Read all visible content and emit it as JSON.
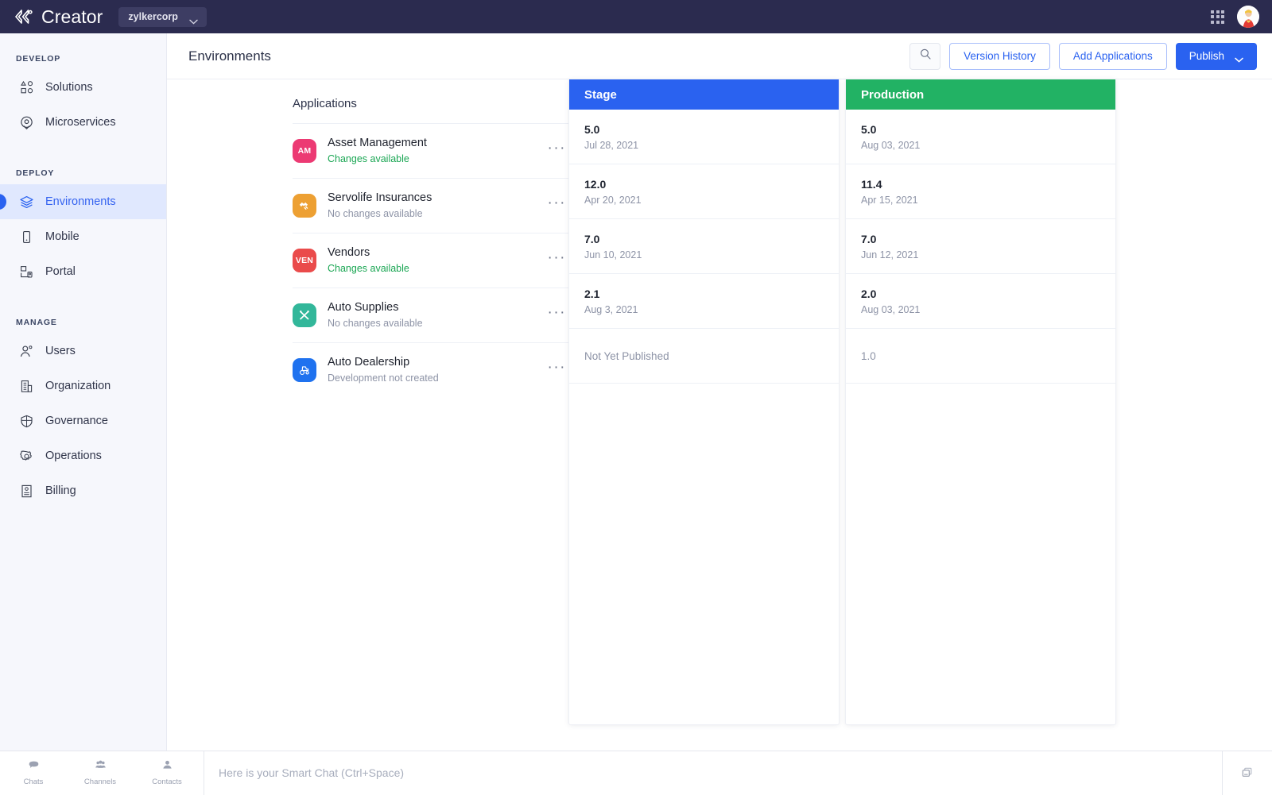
{
  "topbar": {
    "logo_icon": "creator-logo-icon",
    "brand": "Creator",
    "org": "zylkercorp",
    "chevron_icon": "chevron-down-icon",
    "apps_grid_icon": "grid-apps-icon",
    "avatar_icon": "user-avatar"
  },
  "sidebar": {
    "sections": [
      {
        "title": "DEVELOP",
        "items": [
          {
            "label": "Solutions",
            "icon": "solutions-icon",
            "active": false
          },
          {
            "label": "Microservices",
            "icon": "microservices-icon",
            "active": false
          }
        ]
      },
      {
        "title": "DEPLOY",
        "items": [
          {
            "label": "Environments",
            "icon": "environments-layers-icon",
            "active": true
          },
          {
            "label": "Mobile",
            "icon": "mobile-icon",
            "active": false
          },
          {
            "label": "Portal",
            "icon": "portal-icon",
            "active": false
          }
        ]
      },
      {
        "title": "MANAGE",
        "items": [
          {
            "label": "Users",
            "icon": "users-icon",
            "active": false
          },
          {
            "label": "Organization",
            "icon": "organization-building-icon",
            "active": false
          },
          {
            "label": "Governance",
            "icon": "governance-shield-icon",
            "active": false
          },
          {
            "label": "Operations",
            "icon": "operations-gear-icon",
            "active": false
          },
          {
            "label": "Billing",
            "icon": "billing-invoice-icon",
            "active": false
          }
        ]
      }
    ]
  },
  "header": {
    "title": "Environments",
    "search_icon": "search-icon",
    "version_history_label": "Version History",
    "add_applications_label": "Add Applications",
    "publish_label": "Publish",
    "publish_chevron_icon": "chevron-down-icon"
  },
  "board": {
    "applications_column_title": "Applications",
    "more_icon": "more-options-icon",
    "columns": [
      {
        "name": "Stage",
        "color": "#2a62f0"
      },
      {
        "name": "Production",
        "color": "#22b264"
      }
    ],
    "applications": [
      {
        "name": "Asset Management",
        "status": "Changes available",
        "status_type": "changes",
        "initials": "AM",
        "icon": "app-initials-badge",
        "color": "#ec3a73",
        "stage_version": "5.0",
        "stage_date": "Jul 28, 2021",
        "production_version": "5.0",
        "production_date": "Aug 03, 2021"
      },
      {
        "name": "Servolife Insurances",
        "status": "No changes available",
        "status_type": "none",
        "initials": "",
        "icon": "handshake-icon",
        "color": "#eda033",
        "stage_version": "12.0",
        "stage_date": "Apr 20, 2021",
        "production_version": "11.4",
        "production_date": "Apr 15, 2021"
      },
      {
        "name": "Vendors",
        "status": "Changes available",
        "status_type": "changes",
        "initials": "VEN",
        "icon": "app-initials-badge",
        "color": "#ea4b4b",
        "stage_version": "7.0",
        "stage_date": "Jun 10, 2021",
        "production_version": "7.0",
        "production_date": "Jun 12, 2021"
      },
      {
        "name": "Auto Supplies",
        "status": "No changes available",
        "status_type": "none",
        "initials": "",
        "icon": "tools-cross-icon",
        "color": "#32b79a",
        "stage_version": "2.1",
        "stage_date": "Aug 3, 2021",
        "production_version": "2.0",
        "production_date": "Aug 03, 2021"
      },
      {
        "name": "Auto Dealership",
        "status": "Development not created",
        "status_type": "none",
        "initials": "",
        "icon": "tractor-icon",
        "color": "#1f72ef",
        "stage_version": "",
        "stage_date": "",
        "stage_placeholder": "Not Yet Published",
        "production_version": "",
        "production_date": "",
        "production_placeholder": "1.0"
      }
    ]
  },
  "bottombar": {
    "tabs": [
      {
        "label": "Chats",
        "icon": "chat-bubble-icon"
      },
      {
        "label": "Channels",
        "icon": "channels-group-icon"
      },
      {
        "label": "Contacts",
        "icon": "contact-person-icon"
      }
    ],
    "chat_placeholder": "Here is your Smart Chat (Ctrl+Space)",
    "chat_value": "",
    "window_icon": "window-restore-icon"
  }
}
